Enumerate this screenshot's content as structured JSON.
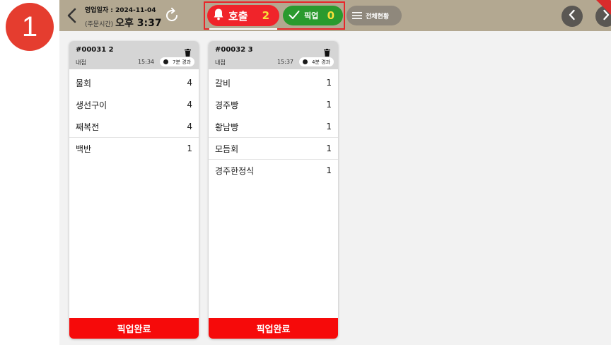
{
  "step_marker": "1",
  "header": {
    "business_date": "영업일자 : 2024-11-04",
    "order_time_label": "(주문시간)",
    "order_time_value": "오후 3:37",
    "tab_call": {
      "label": "호출",
      "count": "2"
    },
    "tab_pickup": {
      "label": "픽업",
      "count": "0"
    },
    "overall_label": "전체현황"
  },
  "cards": [
    {
      "order_no": "#00031  2",
      "store": "내점",
      "time": "15:34",
      "elapsed": "7분 경과",
      "items": [
        {
          "name": "물회",
          "qty": "4"
        },
        {
          "name": "생선구이",
          "qty": "4"
        },
        {
          "name": "째복전",
          "qty": "4"
        },
        {
          "name": "백반",
          "qty": "1"
        }
      ],
      "action": "픽업완료"
    },
    {
      "order_no": "#00032  3",
      "store": "내점",
      "time": "15:37",
      "elapsed": "4분 경과",
      "items": [
        {
          "name": "갈비",
          "qty": "1"
        },
        {
          "name": "경주빵",
          "qty": "1"
        },
        {
          "name": "황남빵",
          "qty": "1"
        },
        {
          "name": "모듬회",
          "qty": "1"
        },
        {
          "name": "경주한정식",
          "qty": "1"
        }
      ],
      "action": "픽업완료"
    }
  ],
  "colors": {
    "header_bg": "#b3a891",
    "call_red": "#f0242a",
    "pickup_green": "#2a9a2e",
    "count_yellow": "#f7e03a",
    "complete_red": "#f60a0a"
  }
}
